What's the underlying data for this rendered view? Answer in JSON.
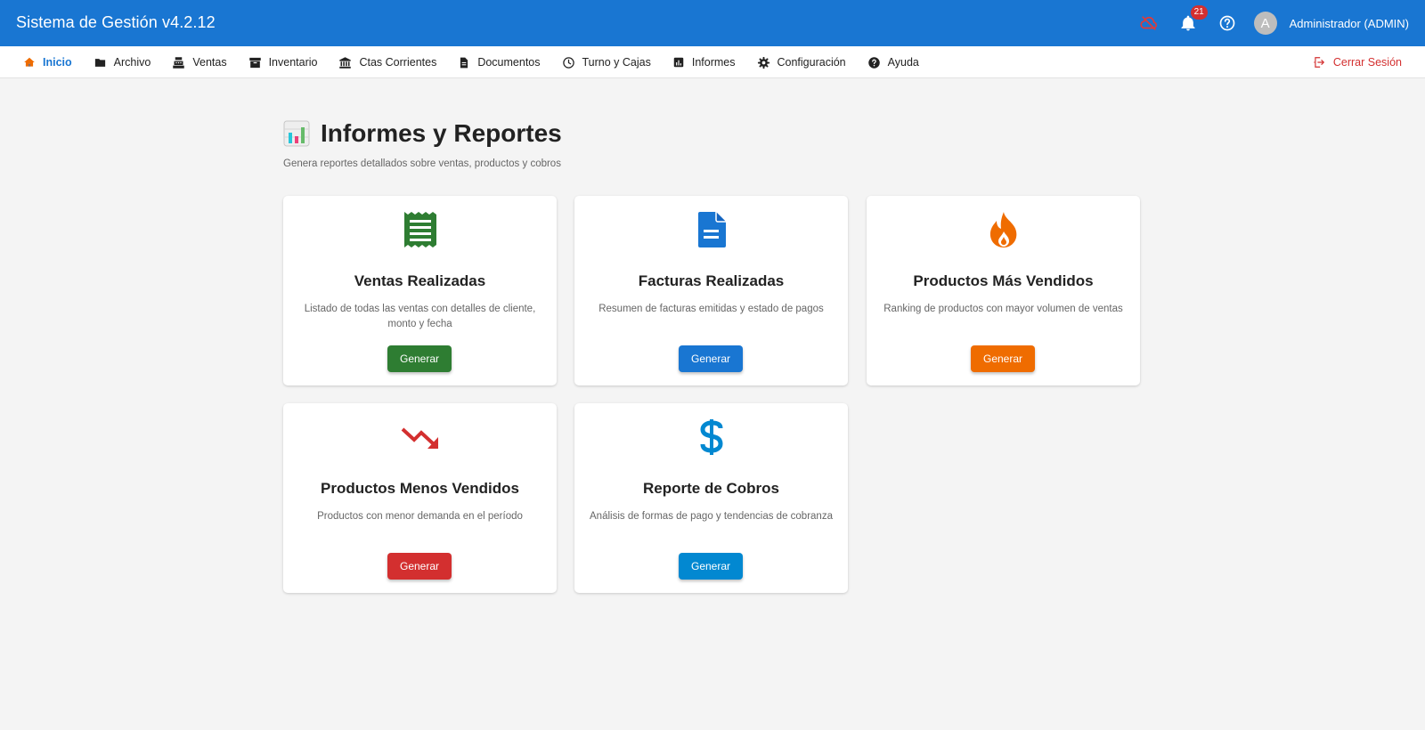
{
  "app": {
    "title": "Sistema de Gestión v4.2.12"
  },
  "topbar": {
    "notifications_count": "21",
    "avatar_letter": "A",
    "user_name": "Administrador (ADMIN)",
    "icons": [
      "cloud-off-icon",
      "bell-icon",
      "help-circle-icon"
    ]
  },
  "nav": {
    "items": [
      {
        "label": "Inicio",
        "icon": "home-icon",
        "active": true
      },
      {
        "label": "Archivo",
        "icon": "folder-icon"
      },
      {
        "label": "Ventas",
        "icon": "cash-register-icon"
      },
      {
        "label": "Inventario",
        "icon": "archive-box-icon"
      },
      {
        "label": "Ctas Corrientes",
        "icon": "bank-icon"
      },
      {
        "label": "Documentos",
        "icon": "document-icon"
      },
      {
        "label": "Turno y Cajas",
        "icon": "clock-icon"
      },
      {
        "label": "Informes",
        "icon": "bar-chart-icon"
      },
      {
        "label": "Configuración",
        "icon": "gear-icon"
      },
      {
        "label": "Ayuda",
        "icon": "help-icon"
      }
    ],
    "logout_label": "Cerrar Sesión"
  },
  "page": {
    "title": "Informes y Reportes",
    "subtitle": "Genera reportes detallados sobre ventas, productos y cobros"
  },
  "colors": {
    "primary": "#1976d2",
    "green": "#2e7d32",
    "orange": "#ef6c00",
    "red": "#d32f2f",
    "light_blue": "#0288d1"
  },
  "cards": [
    {
      "title": "Ventas Realizadas",
      "description": "Listado de todas las ventas con detalles de cliente, monto y fecha",
      "button": "Generar",
      "icon": "receipt-icon",
      "color": "#2e7d32"
    },
    {
      "title": "Facturas Realizadas",
      "description": "Resumen de facturas emitidas y estado de pagos",
      "button": "Generar",
      "icon": "invoice-icon",
      "color": "#1976d2"
    },
    {
      "title": "Productos Más Vendidos",
      "description": "Ranking de productos con mayor volumen de ventas",
      "button": "Generar",
      "icon": "fire-icon",
      "color": "#ef6c00"
    },
    {
      "title": "Productos Menos Vendidos",
      "description": "Productos con menor demanda en el período",
      "button": "Generar",
      "icon": "trending-down-icon",
      "color": "#d32f2f"
    },
    {
      "title": "Reporte de Cobros",
      "description": "Análisis de formas de pago y tendencias de cobranza",
      "button": "Generar",
      "icon": "dollar-icon",
      "color": "#0288d1"
    }
  ]
}
